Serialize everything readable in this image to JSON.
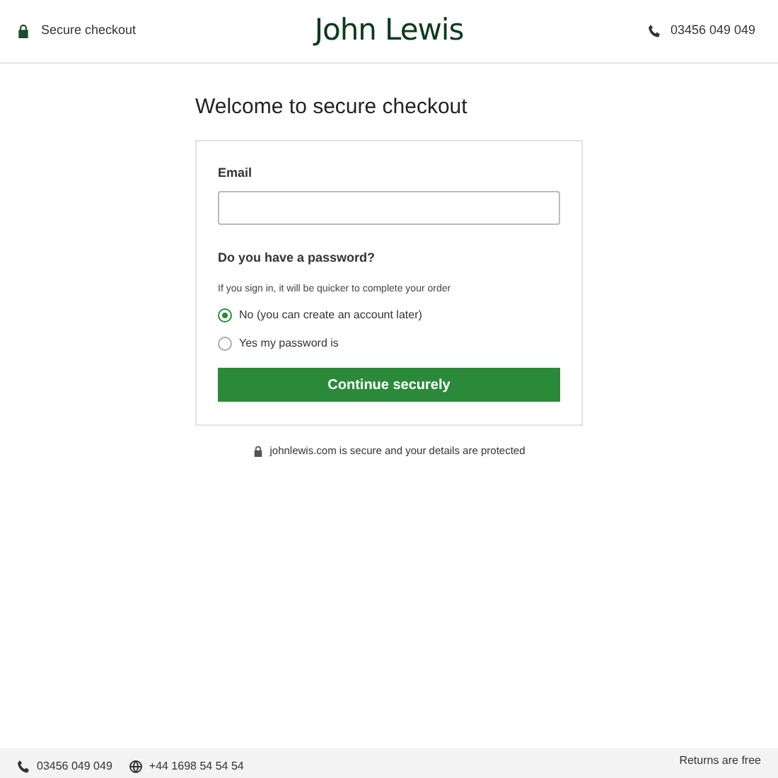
{
  "header": {
    "secure_label": "Secure checkout",
    "logo": "John Lewis",
    "phone": "03456 049 049"
  },
  "title": "Welcome to secure checkout",
  "form": {
    "email": {
      "label": "Email"
    },
    "password_question": "Do you have a password?",
    "hint": "If you sign in, it will be quicker to complete your order",
    "options": [
      {
        "label": "No (you can create an account later)",
        "selected": true
      },
      {
        "label": "Yes my password is",
        "selected": false
      }
    ],
    "submit": "Continue securely"
  },
  "security_note": "johnlewis.com is secure and your details are protected",
  "footer": {
    "phone": "03456 049 049",
    "intl_phone": "+44 1698 54 54 54",
    "returns": "Returns are free"
  }
}
